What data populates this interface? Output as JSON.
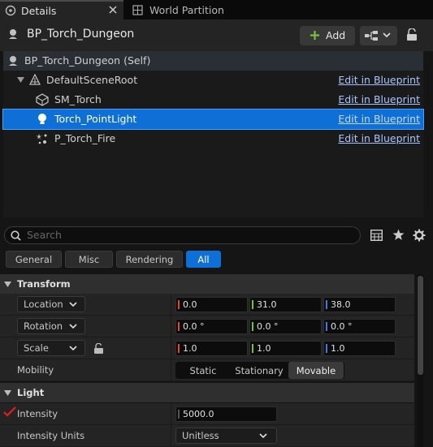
{
  "tabs": [
    {
      "label": "Details",
      "active": true
    },
    {
      "label": "World Partition",
      "active": false
    }
  ],
  "actor": {
    "title": "BP_Torch_Dungeon"
  },
  "toolbar": {
    "add_label": "Add"
  },
  "tree": {
    "self_label": "BP_Torch_Dungeon (Self)",
    "edit_label": "Edit in Blueprint",
    "items": [
      {
        "label": "DefaultSceneRoot",
        "icon": "scene-root-icon"
      },
      {
        "label": "SM_Torch",
        "icon": "static-mesh-icon"
      },
      {
        "label": "Torch_PointLight",
        "icon": "point-light-icon",
        "selected": true
      },
      {
        "label": "P_Torch_Fire",
        "icon": "particle-system-icon"
      }
    ]
  },
  "search": {
    "placeholder": "Search"
  },
  "filters": [
    "General",
    "Misc",
    "Rendering",
    "All"
  ],
  "filter_selected": "All",
  "transform": {
    "section_label": "Transform",
    "location": {
      "label": "Location",
      "x": "0.0",
      "y": "31.0",
      "z": "38.0"
    },
    "rotation": {
      "label": "Rotation",
      "x": "0.0 °",
      "y": "0.0 °",
      "z": "0.0 °"
    },
    "scale": {
      "label": "Scale",
      "x": "1.0",
      "y": "1.0",
      "z": "1.0"
    },
    "mobility": {
      "label": "Mobility",
      "options": [
        "Static",
        "Stationary",
        "Movable"
      ],
      "selected": "Movable"
    }
  },
  "light": {
    "section_label": "Light",
    "intensity": {
      "label": "Intensity",
      "value": "5000.0"
    },
    "intensity_units": {
      "label": "Intensity Units",
      "value": "Unitless"
    }
  },
  "colors": {
    "accent": "#0e70d6",
    "axis_x": "#e04a2a",
    "axis_y": "#7ac13a",
    "axis_z": "#3a7de0",
    "add_plus": "#7ac13a",
    "annotation": "#e02020"
  }
}
